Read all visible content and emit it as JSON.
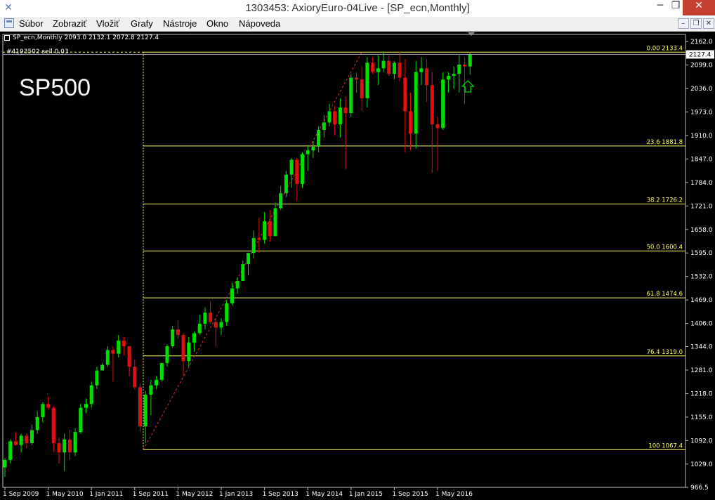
{
  "window": {
    "title": "1303453: AxioryEuro-04Live - [SP_ecn,Monthly]",
    "minimize": "─",
    "maximize": "❐",
    "close": "✕"
  },
  "menu": {
    "items": [
      "Súbor",
      "Zobraziť",
      "Vložiť",
      "Grafy",
      "Nástroje",
      "Okno",
      "Nápoveda"
    ],
    "mdi_minimize": "–",
    "mdi_restore": "❐",
    "mdi_close": "✕"
  },
  "chart_header": {
    "symbol_info": "SP_ecn,Monthly  2093.0 2132.1 2072.8 2127.4",
    "order_info": "#41935​02 sell 0.03",
    "overlay_title": "SP500"
  },
  "chart_data": {
    "type": "candlestick",
    "symbol": "SP_ecn",
    "timeframe": "Monthly",
    "ohlc_last": [
      2093.0,
      2132.1,
      2072.8,
      2127.4
    ],
    "y_axis": {
      "range": [
        966.5,
        2181.0
      ],
      "ticks": [
        "2162.0",
        "2099.0",
        "2036.0",
        "1973.0",
        "1910.0",
        "1847.0",
        "1784.0",
        "1721.0",
        "1658.0",
        "1595.0",
        "1532.0",
        "1469.0",
        "1406.0",
        "1344.0",
        "1281.0",
        "1218.0",
        "1155.0",
        "1092.0",
        "1029.0",
        "966.5"
      ],
      "current_price": "2127.4"
    },
    "x_axis": {
      "ticks": [
        "1 Sep 2009",
        "1 May 2010",
        "1 Jan 2011",
        "1 Sep 2011",
        "1 May 2012",
        "1 Jan 2013",
        "1 Sep 2013",
        "1 May 2014",
        "1 Jan 2015",
        "1 Sep 2015",
        "1 May 2016"
      ]
    },
    "fibonacci": {
      "color": "#ffff66",
      "levels": [
        {
          "pct": "0.00",
          "price": "2133.4"
        },
        {
          "pct": "23.6",
          "price": "1881.8"
        },
        {
          "pct": "38.2",
          "price": "1726.2"
        },
        {
          "pct": "50.0",
          "price": "1600.4"
        },
        {
          "pct": "61.8",
          "price": "1474.6"
        },
        {
          "pct": "76.4",
          "price": "1319.0"
        },
        {
          "pct": "100",
          "price": "1067.4"
        }
      ]
    },
    "colors": {
      "bull": "#00e000",
      "bear": "#e01010",
      "background": "#000000",
      "grid": "none",
      "trendline": "#e03030"
    },
    "candles": [
      [
        1020,
        1045,
        995,
        1040
      ],
      [
        1040,
        1095,
        1030,
        1090
      ],
      [
        1090,
        1115,
        1078,
        1080
      ],
      [
        1080,
        1110,
        1060,
        1105
      ],
      [
        1105,
        1112,
        1072,
        1085
      ],
      [
        1085,
        1135,
        1080,
        1120
      ],
      [
        1120,
        1170,
        1110,
        1155
      ],
      [
        1155,
        1195,
        1140,
        1190
      ],
      [
        1190,
        1210,
        1175,
        1180
      ],
      [
        1180,
        1185,
        1060,
        1085
      ],
      [
        1085,
        1100,
        1030,
        1060
      ],
      [
        1060,
        1110,
        1010,
        1095
      ],
      [
        1095,
        1120,
        1040,
        1060
      ],
      [
        1060,
        1125,
        1050,
        1115
      ],
      [
        1115,
        1190,
        1110,
        1180
      ],
      [
        1180,
        1205,
        1165,
        1190
      ],
      [
        1190,
        1250,
        1180,
        1240
      ],
      [
        1240,
        1290,
        1230,
        1280
      ],
      [
        1280,
        1300,
        1285,
        1295
      ],
      [
        1295,
        1345,
        1290,
        1335
      ],
      [
        1335,
        1345,
        1250,
        1325
      ],
      [
        1325,
        1375,
        1315,
        1360
      ],
      [
        1360,
        1370,
        1320,
        1345
      ],
      [
        1345,
        1345,
        1265,
        1290
      ],
      [
        1290,
        1310,
        1230,
        1235
      ],
      [
        1235,
        1245,
        1115,
        1130
      ],
      [
        1130,
        1225,
        1085,
        1215
      ],
      [
        1215,
        1255,
        1160,
        1240
      ],
      [
        1240,
        1265,
        1230,
        1255
      ],
      [
        1255,
        1300,
        1250,
        1300
      ],
      [
        1300,
        1350,
        1290,
        1345
      ],
      [
        1345,
        1400,
        1340,
        1390
      ],
      [
        1390,
        1415,
        1365,
        1375
      ],
      [
        1375,
        1380,
        1265,
        1305
      ],
      [
        1305,
        1370,
        1290,
        1355
      ],
      [
        1355,
        1385,
        1330,
        1380
      ],
      [
        1380,
        1430,
        1375,
        1405
      ],
      [
        1405,
        1450,
        1390,
        1435
      ],
      [
        1435,
        1465,
        1405,
        1410
      ],
      [
        1410,
        1420,
        1345,
        1395
      ],
      [
        1395,
        1420,
        1375,
        1410
      ],
      [
        1410,
        1470,
        1400,
        1460
      ],
      [
        1460,
        1515,
        1455,
        1500
      ],
      [
        1500,
        1530,
        1485,
        1520
      ],
      [
        1520,
        1575,
        1520,
        1565
      ],
      [
        1565,
        1595,
        1535,
        1595
      ],
      [
        1595,
        1655,
        1580,
        1635
      ],
      [
        1635,
        1690,
        1595,
        1630
      ],
      [
        1630,
        1705,
        1620,
        1680
      ],
      [
        1680,
        1710,
        1625,
        1640
      ],
      [
        1640,
        1730,
        1640,
        1715
      ],
      [
        1715,
        1775,
        1710,
        1755
      ],
      [
        1755,
        1815,
        1745,
        1805
      ],
      [
        1805,
        1850,
        1770,
        1845
      ],
      [
        1845,
        1850,
        1735,
        1780
      ],
      [
        1780,
        1865,
        1770,
        1860
      ],
      [
        1860,
        1885,
        1815,
        1870
      ],
      [
        1870,
        1895,
        1850,
        1880
      ],
      [
        1880,
        1935,
        1865,
        1925
      ],
      [
        1925,
        1965,
        1905,
        1945
      ],
      [
        1945,
        1995,
        1935,
        1975
      ],
      [
        1975,
        1990,
        1910,
        1940
      ],
      [
        1940,
        2010,
        1905,
        1985
      ],
      [
        1985,
        2015,
        1820,
        1970
      ],
      [
        1970,
        2075,
        1960,
        2065
      ],
      [
        2065,
        2080,
        2025,
        2060
      ],
      [
        2060,
        2095,
        1975,
        2010
      ],
      [
        2010,
        2120,
        1985,
        2105
      ],
      [
        2105,
        2120,
        2075,
        2080
      ],
      [
        2080,
        2125,
        2045,
        2090
      ],
      [
        2090,
        2135,
        2080,
        2110
      ],
      [
        2110,
        2125,
        2070,
        2075
      ],
      [
        2075,
        2110,
        2060,
        2105
      ],
      [
        2105,
        2135,
        2055,
        2065
      ],
      [
        2065,
        2115,
        1865,
        1975
      ],
      [
        1975,
        2025,
        1870,
        1915
      ],
      [
        1915,
        2110,
        1875,
        2080
      ],
      [
        2080,
        2120,
        2045,
        2090
      ],
      [
        2090,
        2115,
        2000,
        2045
      ],
      [
        2045,
        2080,
        1810,
        1940
      ],
      [
        1940,
        1960,
        1815,
        1930
      ],
      [
        1930,
        2080,
        1925,
        2060
      ],
      [
        2060,
        2080,
        2025,
        2070
      ],
      [
        2070,
        2095,
        2035,
        2075
      ],
      [
        2075,
        2125,
        2025,
        2100
      ],
      [
        2100,
        2120,
        1995,
        2095
      ],
      [
        2095,
        2132,
        2073,
        2127
      ]
    ]
  }
}
